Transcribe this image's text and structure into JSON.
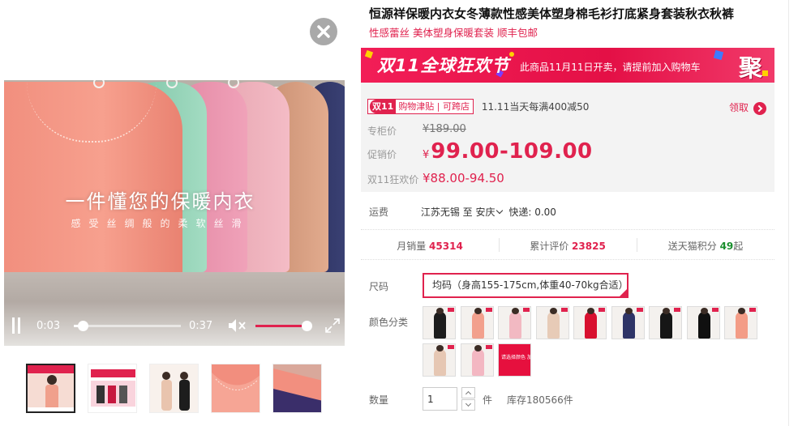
{
  "product": {
    "title": "恒源祥保暖内衣女冬薄款性感美体塑身棉毛衫打底紧身套装秋衣秋裤",
    "subtitle": "性感蕾丝 美体塑身保暖套装 顺丰包邮"
  },
  "video": {
    "overlay_title": "一件懂您的保暖内衣",
    "overlay_subtitle": "感受丝绸般的柔软丝滑",
    "current_time": "0:03",
    "total_time": "0:37",
    "progress": 0.081,
    "volume": 0.9
  },
  "thumbnails": [
    {
      "active": true
    },
    {
      "active": false
    },
    {
      "active": false
    },
    {
      "active": false
    },
    {
      "active": false
    }
  ],
  "banner": {
    "logo_text": "双11全球狂欢节",
    "notice": "此商品11月11日开卖，请提前加入购物车",
    "ju_text": "聚"
  },
  "price": {
    "coupon_badge": "双11",
    "coupon_tag": "购物津贴",
    "coupon_tag2": "可跨店",
    "coupon_text": "11.11当天每满400减50",
    "claim_label": "领取",
    "original_label": "专柜价",
    "original_value": "¥189.00",
    "promo_label": "促销价",
    "promo_currency": "¥",
    "promo_value": "99.00-109.00",
    "d11_label": "双11狂欢价",
    "d11_value": "¥88.00-94.50"
  },
  "shipping": {
    "label": "运费",
    "origin": "江苏无锡",
    "to": "至",
    "destination": "安庆",
    "fee": "快递: 0.00"
  },
  "stats": {
    "monthly_label": "月销量",
    "monthly_value": "45314",
    "reviews_label": "累计评价",
    "reviews_value": "23825",
    "points_label": "送天猫积分",
    "points_value": "49",
    "points_suffix": "起"
  },
  "sku": {
    "size_label": "尺码",
    "size_value": "均码（身高155-175cm,体重40-70kg合适）",
    "color_label": "颜色分类",
    "swatches": [
      {
        "color": "#1c1c1c"
      },
      {
        "color": "#f2a08d"
      },
      {
        "color": "#f2b9c2"
      },
      {
        "color": "#e7cbb7"
      },
      {
        "color": "#d8102f"
      },
      {
        "color": "#2e3467"
      },
      {
        "color": "#161616"
      },
      {
        "color": "#101010"
      },
      {
        "color": "#f39c86"
      },
      {
        "color": "#e6c7b3"
      },
      {
        "color": "#f3b7c2"
      }
    ],
    "special_swatch_text": "请选择颜色 加入购物车即可",
    "quantity_label": "数量",
    "quantity_value": "1",
    "quantity_unit": "件",
    "stock_text": "库存180566件"
  },
  "colors": {
    "accent": "#e0224e",
    "banner": "#f21e57",
    "points": "#1a8f2e"
  }
}
